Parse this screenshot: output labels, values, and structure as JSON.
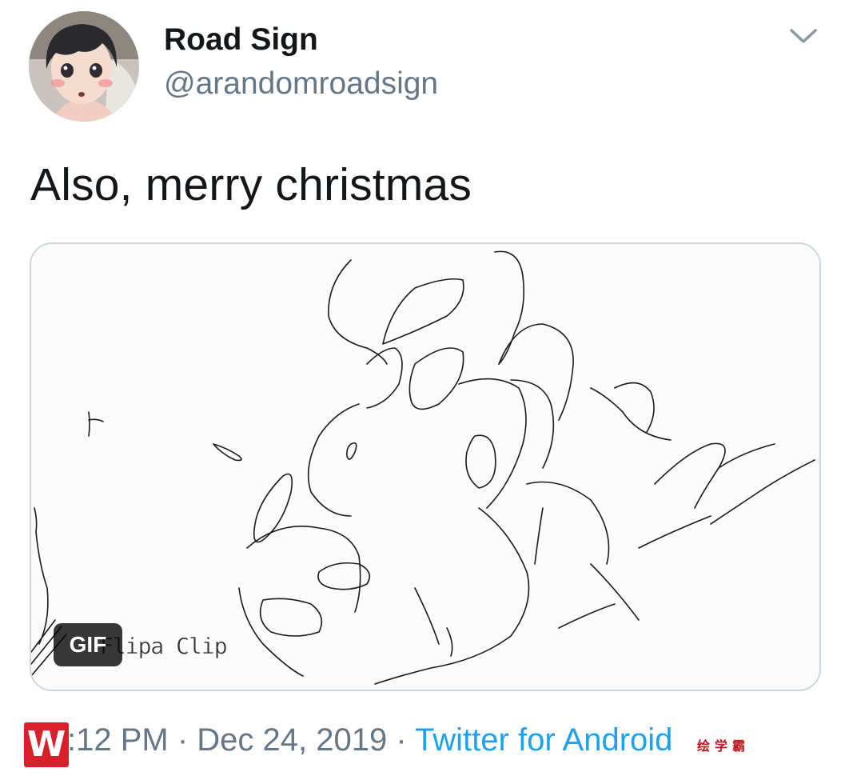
{
  "author": {
    "display_name": "Road Sign",
    "handle": "@arandomroadsign"
  },
  "tweet": {
    "text": "Also, merry christmas"
  },
  "media": {
    "badge": "GIF",
    "overlay_watermark": "Flipa Clip"
  },
  "meta": {
    "time": ":12 PM",
    "separator": " · ",
    "date": "Dec 24, 2019",
    "source": "Twitter for Android"
  },
  "watermark": {
    "logo_letter": "W",
    "text": "绘学霸"
  },
  "colors": {
    "primary_text": "#14171a",
    "secondary_text": "#657786",
    "link": "#1da1f2",
    "border": "#ccd6dd",
    "watermark_red": "#d7202a"
  },
  "icons": {
    "menu": "chevron-down-icon",
    "avatar": "avatar-image"
  }
}
